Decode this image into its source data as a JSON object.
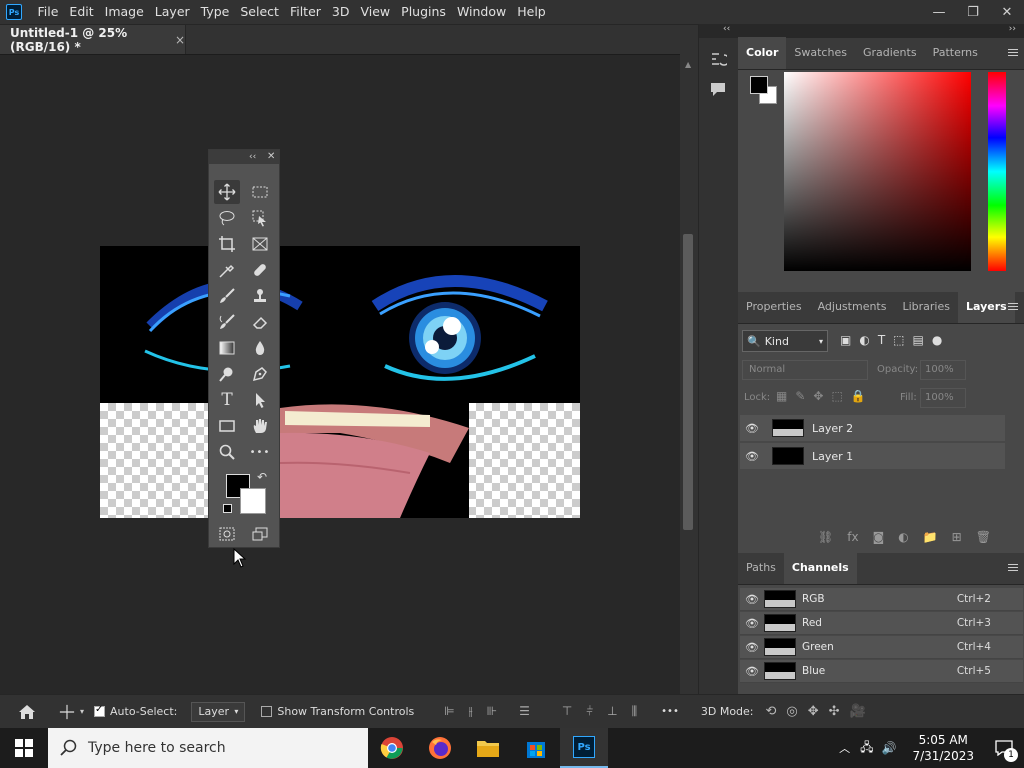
{
  "menubar": {
    "app_logo": "Ps",
    "items": [
      "File",
      "Edit",
      "Image",
      "Layer",
      "Type",
      "Select",
      "Filter",
      "3D",
      "View",
      "Plugins",
      "Window",
      "Help"
    ],
    "window_controls": [
      "—",
      "❐",
      "✕"
    ]
  },
  "document_tab": {
    "title": "Untitled-1 @ 25% (RGB/16) *",
    "close": "×"
  },
  "toolbox": {
    "collapse": "‹‹",
    "close": "✕",
    "tools": [
      "move-tool",
      "marquee-tool",
      "lasso-tool",
      "object-selection-tool",
      "crop-tool",
      "frame-tool",
      "eyedropper-tool",
      "healing-brush-tool",
      "brush-tool",
      "clone-stamp-tool",
      "history-brush-tool",
      "eraser-tool",
      "gradient-tool",
      "blur-tool",
      "dodge-tool",
      "pen-tool",
      "type-tool",
      "path-selection-tool",
      "rectangle-tool",
      "hand-tool",
      "zoom-tool",
      "more-tools",
      "quick-mask",
      "screen-mode"
    ],
    "type_glyph": "T",
    "more_glyph": "•••",
    "swap_glyph": "↶"
  },
  "color_panel": {
    "tabs": [
      "Color",
      "Swatches",
      "Gradients",
      "Patterns"
    ],
    "active_tab": "Color",
    "foreground": "#000000",
    "background": "#ffffff"
  },
  "layers_panel": {
    "tabs": [
      "Properties",
      "Adjustments",
      "Libraries",
      "Layers"
    ],
    "active_tab": "Layers",
    "filter_kind": "Kind",
    "blend_mode": "Normal",
    "opacity_label": "Opacity:",
    "opacity_value": "100%",
    "lock_label": "Lock:",
    "fill_label": "Fill:",
    "fill_value": "100%",
    "layers": [
      "Layer 2",
      "Layer 1"
    ],
    "filter_glyph_type": "T",
    "fx_label": "fx"
  },
  "channels_panel": {
    "tabs": [
      "Paths",
      "Channels"
    ],
    "active_tab": "Channels",
    "channels": [
      {
        "name": "RGB",
        "shortcut": "Ctrl+2"
      },
      {
        "name": "Red",
        "shortcut": "Ctrl+3"
      },
      {
        "name": "Green",
        "shortcut": "Ctrl+4"
      },
      {
        "name": "Blue",
        "shortcut": "Ctrl+5"
      }
    ]
  },
  "options_bar": {
    "auto_select_label": "Auto-Select:",
    "auto_select_checked": true,
    "auto_select_target": "Layer",
    "show_transform_label": "Show Transform Controls",
    "show_transform_checked": false,
    "more": "•••",
    "mode_3d_label": "3D Mode:"
  },
  "taskbar": {
    "search_placeholder": "Type here to search",
    "apps": [
      "chrome",
      "firefox",
      "file-explorer",
      "microsoft-store",
      "photoshop"
    ],
    "photoshop_label": "Ps",
    "time": "5:05 AM",
    "date": "7/31/2023",
    "notification_count": "1"
  }
}
